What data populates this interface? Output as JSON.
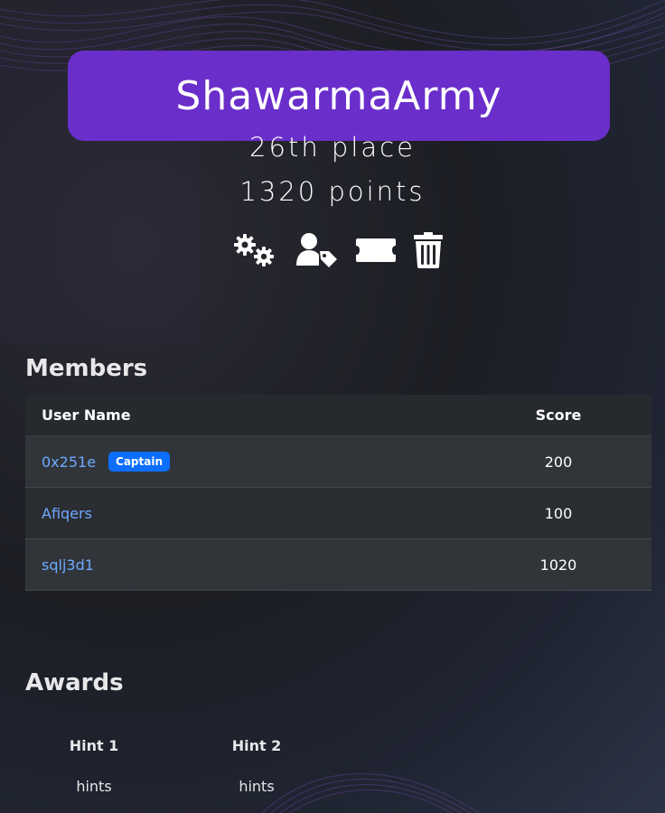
{
  "team": {
    "name": "ShawarmaArmy",
    "place": "26th place",
    "points": "1320 points",
    "banner_color": "#6a2ecb"
  },
  "actions": [
    {
      "icon": "gears-icon",
      "label": "Team settings"
    },
    {
      "icon": "user-tag-icon",
      "label": "Captain"
    },
    {
      "icon": "ticket-icon",
      "label": "Invite"
    },
    {
      "icon": "trash-icon",
      "label": "Disband team"
    }
  ],
  "members": {
    "title": "Members",
    "columns": [
      "User Name",
      "Score"
    ],
    "rows": [
      {
        "name": "0x251e",
        "badge": "Captain",
        "score": "200"
      },
      {
        "name": "Afiqers",
        "badge": "",
        "score": "100"
      },
      {
        "name": "sqlj3d1",
        "badge": "",
        "score": "1020"
      }
    ],
    "link_color": "#6ea8fe",
    "badge_color": "#0d6efd"
  },
  "awards": {
    "title": "Awards",
    "items": [
      {
        "name": "Hint 1",
        "category": "hints"
      },
      {
        "name": "Hint 2",
        "category": "hints"
      }
    ]
  }
}
